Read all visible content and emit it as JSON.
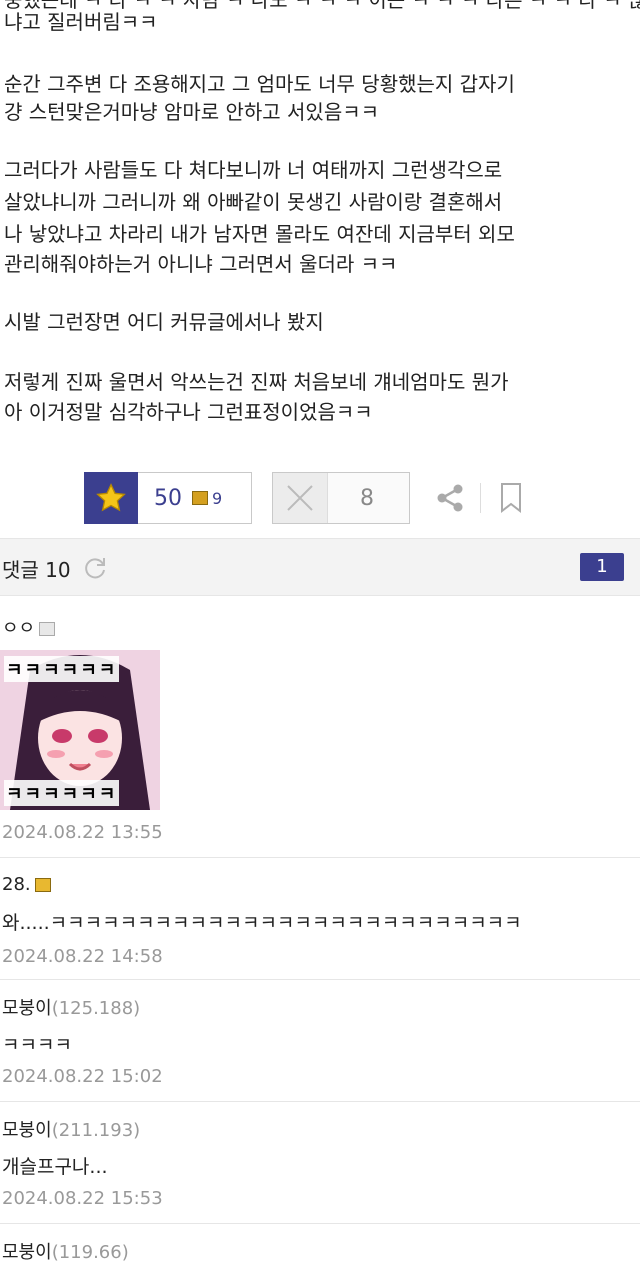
{
  "post": {
    "line0": "중했는데 ㅋ 다 ㅋ ㅋ 사람 ㅋ 나도 ㅋ ㅋ ㅋ 이는 ㅋ ㅋ ㅋ 다른 ㅋ ㅋ 다 ㅋ 않",
    "line1": "냐고 질러버림ㅋㅋ",
    "p2a": "순간 그주변 다 조용해지고 그 엄마도 너무 당황했는지 갑자기",
    "p2b": "걍 스턴맞은거마냥 암마로 안하고 서있음ㅋㅋ",
    "p3a": "그러다가 사람들도 다 쳐다보니까 너 여태까지 그런생각으로",
    "p3b": "살았냐니까 그러니까 왜 아빠같이 못생긴 사람이랑 결혼해서",
    "p3c": "나 낳았냐고 차라리 내가 남자면 몰라도 여잔데 지금부터 외모",
    "p3d": "관리해줘야하는거 아니냐 그러면서 울더라 ㅋㅋ",
    "p4": "시발 그런장면 어디 커뮤글에서나 봤지",
    "p5a": "저렇게 진짜 울면서 악쓰는건 진짜 처음보네 걔네엄마도 뭔가",
    "p5b": "아 이거정말 심각하구나 그런표정이었음ㅋㅋ"
  },
  "votes": {
    "recommend_count": "50",
    "fixed_count": "9",
    "not_recommend_count": "8",
    "accent": "#3b3f8f"
  },
  "comments_header": {
    "label": "댓글 10",
    "page": "1"
  },
  "comments": [
    {
      "author": "ㅇㅇ",
      "ip": "",
      "text": "",
      "sticker_text_top": "ㅋㅋㅋㅋㅋㅋ",
      "sticker_text_bottom": "ㅋㅋㅋㅋㅋㅋ",
      "date": "2024.08.22 13:55"
    },
    {
      "author": "28.",
      "ip": "",
      "text": "와.....ㅋㅋㅋㅋㅋㅋㅋㅋㅋㅋㅋㅋㅋㅋㅋㅋㅋㅋㅋㅋㅋㅋㅋㅋㅋㅋㅋ",
      "date": "2024.08.22 14:58"
    },
    {
      "author": "모붕이",
      "ip": "(125.188)",
      "text": "ㅋㅋㅋㅋ",
      "date": "2024.08.22 15:02"
    },
    {
      "author": "모붕이",
      "ip": "(211.193)",
      "text": "개슬프구나...",
      "date": "2024.08.22 15:53"
    },
    {
      "author": "모붕이",
      "ip": "(119.66)",
      "text": "",
      "date": ""
    }
  ]
}
